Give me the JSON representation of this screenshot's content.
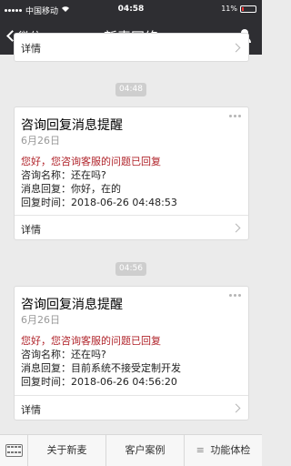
{
  "status_bar": {
    "carrier": "中国移动",
    "wifi_icon": "wifi-icon",
    "time": "04:58",
    "battery": "11%"
  },
  "nav": {
    "back_label": "微信",
    "title": "新麦网络",
    "user_icon": "user-icon"
  },
  "cards": [
    {
      "footer_label": "详情"
    },
    {
      "title": "咨询回复消息提醒",
      "date": "6月26日",
      "greeting": "您好，您咨询客服的问题已回复",
      "lines": [
        "咨询名称：还在吗?",
        "消息回复：你好，在的",
        "回复时间：2018-06-26 04:48:53"
      ],
      "footer_label": "详情"
    },
    {
      "title": "咨询回复消息提醒",
      "date": "6月26日",
      "greeting": "您好，您咨询客服的问题已回复",
      "lines": [
        "咨询名称：还在吗?",
        "消息回复：目前系统不接受定制开发",
        "回复时间：2018-06-26 04:56:20"
      ],
      "footer_label": "详情"
    }
  ],
  "timestamps": [
    "04:48",
    "04:56"
  ],
  "bottom_menu": {
    "items": [
      "关于新麦",
      "客户案例",
      "功能体检"
    ],
    "menu_glyph": "≡"
  },
  "colors": {
    "nav_bg": "#2e2e32",
    "accent_red": "#b0232a",
    "background": "#ebebeb"
  }
}
